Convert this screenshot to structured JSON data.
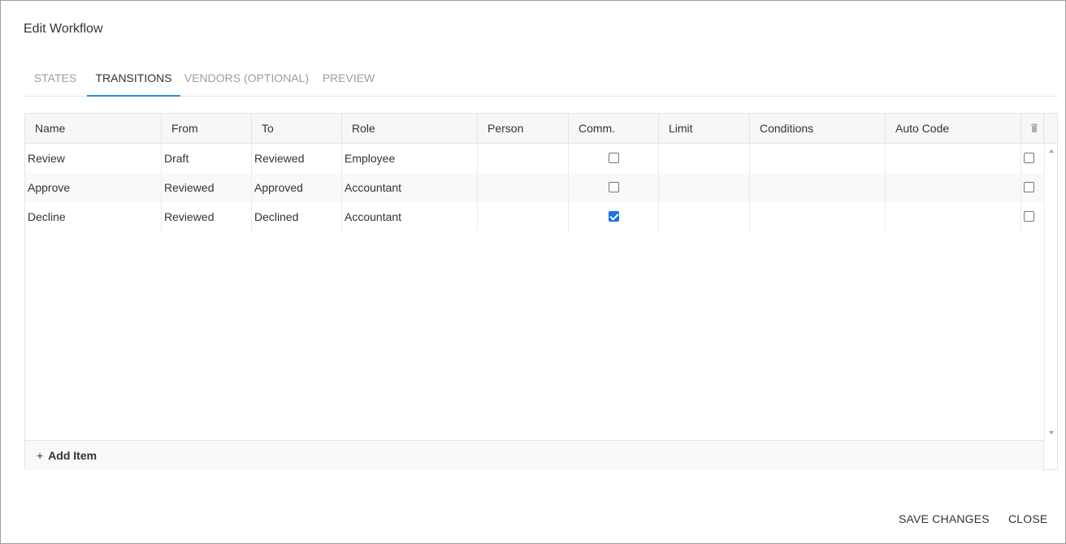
{
  "dialog": {
    "title": "Edit Workflow"
  },
  "tabs": [
    {
      "label": "STATES",
      "active": false
    },
    {
      "label": "TRANSITIONS",
      "active": true
    },
    {
      "label": "VENDORS (OPTIONAL)",
      "active": false
    },
    {
      "label": "PREVIEW",
      "active": false
    }
  ],
  "grid": {
    "columns": [
      "Name",
      "From",
      "To",
      "Role",
      "Person",
      "Comm.",
      "Limit",
      "Conditions",
      "Auto Code"
    ],
    "delete_column_icon": "trash-icon",
    "rows": [
      {
        "name": "Review",
        "from": "Draft",
        "to": "Reviewed",
        "role": "Employee",
        "person": "",
        "comm": false,
        "limit": "",
        "conditions": "",
        "auto_code": "",
        "selected": false
      },
      {
        "name": "Approve",
        "from": "Reviewed",
        "to": "Approved",
        "role": "Accountant",
        "person": "",
        "comm": false,
        "limit": "",
        "conditions": "",
        "auto_code": "",
        "selected": false
      },
      {
        "name": "Decline",
        "from": "Reviewed",
        "to": "Declined",
        "role": "Accountant",
        "person": "",
        "comm": true,
        "limit": "",
        "conditions": "",
        "auto_code": "",
        "selected": false
      }
    ],
    "add_item": {
      "icon": "+",
      "label": "Add Item"
    }
  },
  "footer": {
    "save_label": "SAVE CHANGES",
    "close_label": "CLOSE"
  },
  "colors": {
    "accent": "#2b8fd6",
    "checkbox_checked": "#1a73e8"
  }
}
